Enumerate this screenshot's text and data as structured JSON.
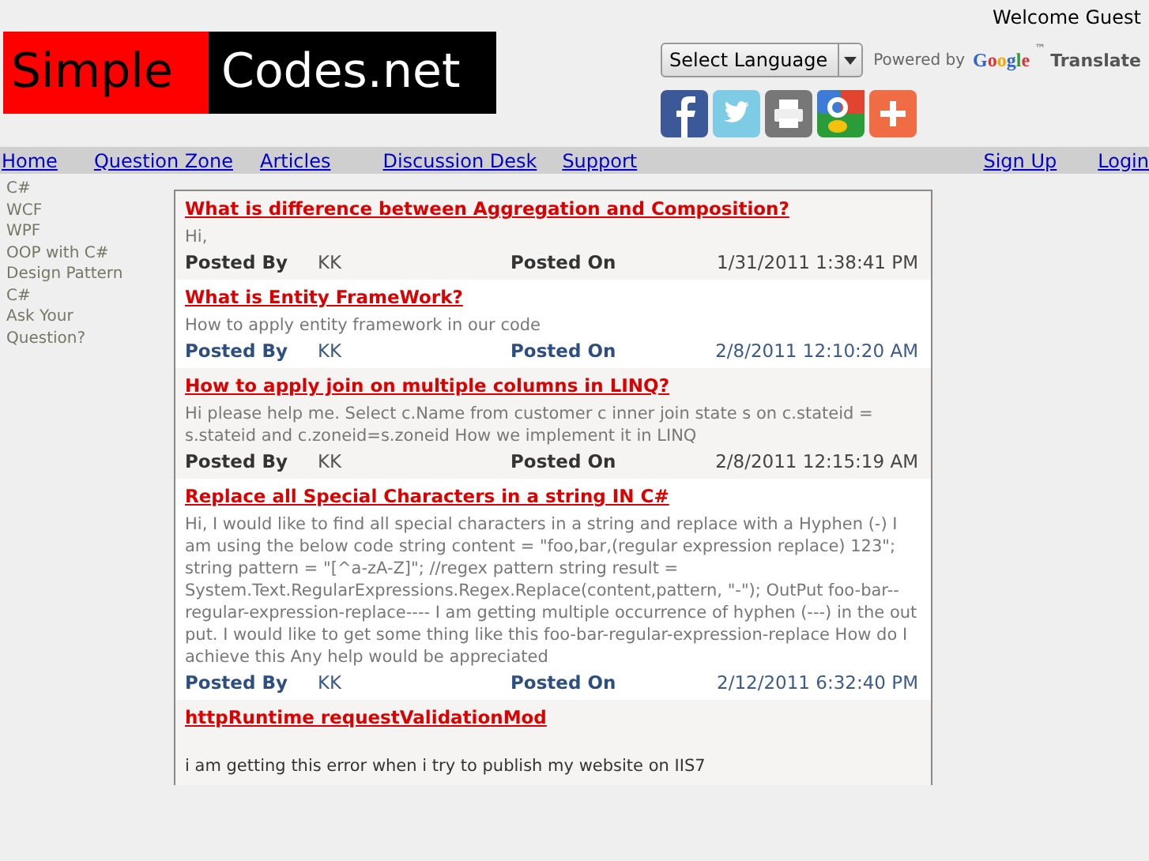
{
  "welcome": "Welcome Guest",
  "logo": {
    "first": "Simple",
    "second": "Codes.net"
  },
  "translate": {
    "select": "Select Language",
    "powered_by": "Powered by",
    "google": "Google",
    "tm": "™",
    "translate": "Translate"
  },
  "nav": {
    "left": [
      "Home",
      "Question Zone",
      "Articles",
      "Discussion Desk",
      "Support"
    ],
    "right": [
      "Sign Up",
      "Login"
    ]
  },
  "sidebar": {
    "items": [
      "C#",
      "WCF",
      "WPF",
      "OOP with C#",
      "Design Pattern C#",
      "Ask Your Question?"
    ]
  },
  "posts": [
    {
      "kind": "plain",
      "title": "What is difference between Aggregation and Composition?",
      "body": "Hi,",
      "posted_by_label": "Posted By",
      "author": "KK",
      "posted_on_label": "Posted On",
      "date": "1/31/2011 1:38:41 PM"
    },
    {
      "kind": "alternate",
      "title": "What is Entity FrameWork?",
      "body": "How to apply entity framework in our code",
      "posted_by_label": "Posted By",
      "author": "KK",
      "posted_on_label": "Posted On",
      "date": "2/8/2011 12:10:20 AM"
    },
    {
      "kind": "plain",
      "title": "How to apply join on multiple columns in LINQ?",
      "body": "Hi please help me. Select c.Name from customer c inner join state s on c.stateid = s.stateid and c.zoneid=s.zoneid How we implement it in LINQ",
      "posted_by_label": "Posted By",
      "author": "KK",
      "posted_on_label": "Posted On",
      "date": "2/8/2011 12:15:19 AM"
    },
    {
      "kind": "alternate",
      "title": "Replace all Special Characters in a string IN C#",
      "body": "Hi, I would like to find all special characters in a string and replace with a Hyphen (-) I am using the below code string content = \"foo,bar,(regular expression replace) 123\"; string pattern = \"[^a-zA-Z]\"; //regex pattern string result = System.Text.RegularExpressions.Regex.Replace(content,pattern, \"-\"); OutPut foo-bar--regular-expression-replace---- I am getting multiple occurrence of hyphen (---) in the out put. I would like to get some thing like this foo-bar-regular-expression-replace How do I achieve this Any help would be appreciated",
      "posted_by_label": "Posted By",
      "author": "KK",
      "posted_on_label": "Posted On",
      "date": "2/12/2011 6:32:40 PM"
    },
    {
      "kind": "plain",
      "title": "httpRuntime requestValidationMod",
      "body": "i am getting this error when i try to publish my website on IIS7"
    }
  ]
}
